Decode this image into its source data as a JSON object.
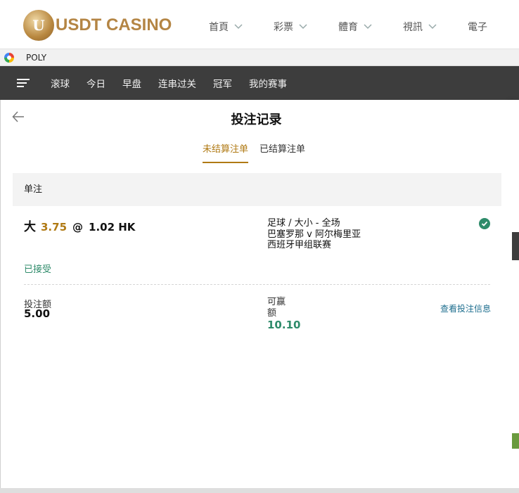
{
  "site": {
    "logo_letter": "U",
    "logo_text": "USDT CASINO",
    "nav": [
      "首頁",
      "彩票",
      "體育",
      "視訊",
      "電子"
    ]
  },
  "browser_bar": {
    "label": "POLY"
  },
  "sports_nav": {
    "tabs": [
      "滚球",
      "今日",
      "早盘",
      "连串过关",
      "冠军",
      "我的赛事"
    ]
  },
  "panel": {
    "title": "投注记录",
    "tabs": [
      "未结算注单",
      "已结算注单"
    ],
    "section": "单注",
    "bet": {
      "pick": "大",
      "line": "3.75",
      "at": "@",
      "odds": "1.02 HK",
      "market": "足球 / 大小 - 全场",
      "match": "巴塞罗那 v 阿尔梅里亚",
      "league": "西班牙甲组联赛",
      "status": "已接受",
      "stake_label": "投注额",
      "stake": "5.00",
      "win_label": "可赢额",
      "win": "10.10",
      "detail_link": "查看投注信息"
    }
  },
  "colors": {
    "accent": "#b07a14",
    "success": "#2e8b6a",
    "dark_nav": "#3d3d3d",
    "link": "#1d6e8e"
  }
}
